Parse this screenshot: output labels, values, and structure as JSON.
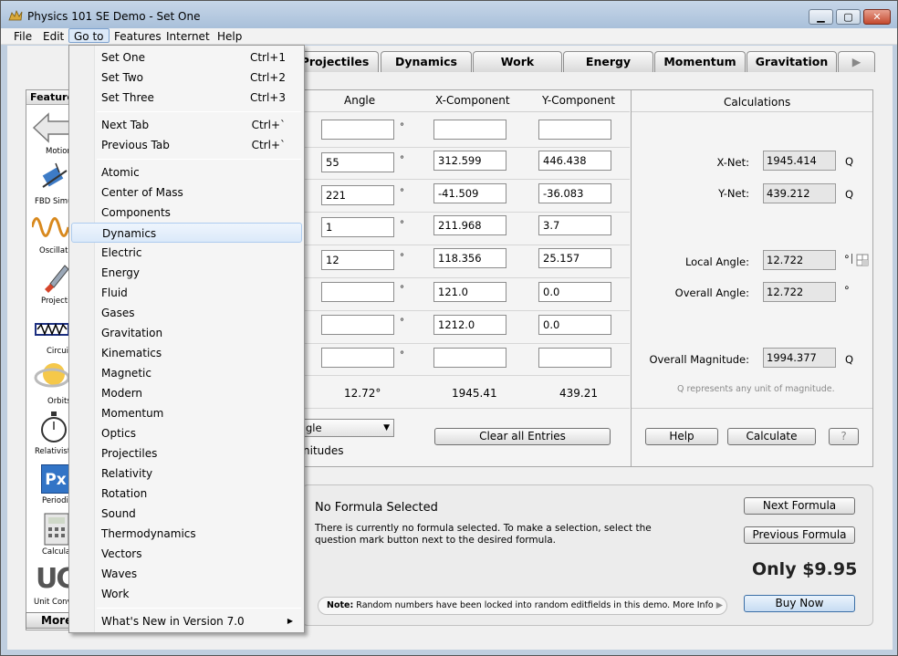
{
  "window": {
    "title": "Physics 101 SE Demo - Set One"
  },
  "menubar": {
    "items": [
      "File",
      "Edit",
      "Go to",
      "Features",
      "Internet",
      "Help"
    ]
  },
  "tabs": {
    "items": [
      "Projectiles",
      "Dynamics",
      "Work",
      "Energy",
      "Momentum",
      "Gravitation"
    ]
  },
  "sidebar": {
    "header": "Features",
    "items": [
      "Motion",
      "FBD Simu",
      "Oscillati",
      "Projectil",
      "Circuit",
      "Orbits",
      "Relativist",
      "Periodic",
      "Calculat",
      "Unit Conv"
    ],
    "more_label": "More",
    "periodic_glyph": "Px",
    "unit_glyph": "UC"
  },
  "table": {
    "headers": [
      "Angle",
      "X-Component",
      "Y-Component"
    ],
    "degree_symbol": "°",
    "rows": [
      {
        "angle": "",
        "x": "",
        "y": ""
      },
      {
        "angle": "55",
        "x": "312.599",
        "y": "446.438"
      },
      {
        "angle": "221",
        "x": "-41.509",
        "y": "-36.083"
      },
      {
        "angle": "1",
        "x": "211.968",
        "y": "3.7"
      },
      {
        "angle": "12",
        "x": "118.356",
        "y": "25.157"
      },
      {
        "angle": "",
        "x": "121.0",
        "y": "0.0"
      },
      {
        "angle": "",
        "x": "1212.0",
        "y": "0.0"
      },
      {
        "angle": "",
        "x": "",
        "y": ""
      }
    ],
    "totals": {
      "angle": "12.72°",
      "x": "1945.41",
      "y": "439.21"
    },
    "select_partial": "gle",
    "magnitudes_partial": "nitudes",
    "clear_button": "Clear all Entries"
  },
  "calculations": {
    "header": "Calculations",
    "xnet_label": "X-Net:",
    "xnet_value": "1945.414",
    "xnet_unit": "Q",
    "ynet_label": "Y-Net:",
    "ynet_value": "439.212",
    "ynet_unit": "Q",
    "local_angle_label": "Local Angle:",
    "local_angle_value": "12.722",
    "local_angle_unit": "°",
    "overall_angle_label": "Overall Angle:",
    "overall_angle_value": "12.722",
    "overall_angle_unit": "°",
    "overall_mag_label": "Overall Magnitude:",
    "overall_mag_value": "1994.377",
    "overall_mag_unit": "Q",
    "note": "Q represents any unit of magnitude.",
    "help_button": "Help",
    "calculate_button": "Calculate",
    "question_button": "?"
  },
  "formula": {
    "title": "No Formula Selected",
    "body_line1": "There is currently no formula selected. To make a selection, select the",
    "body_line2": "question mark button next to the desired formula.",
    "next_button": "Next Formula",
    "previous_button": "Previous Formula",
    "price": "Only $9.95",
    "buy_button": "Buy Now",
    "note_label": "Note:",
    "note_text": "Random numbers have been locked into random editfields in this demo.",
    "more_info": "More Info"
  },
  "goto_menu": {
    "items": [
      {
        "label": "Set One",
        "shortcut": "Ctrl+1"
      },
      {
        "label": "Set Two",
        "shortcut": "Ctrl+2"
      },
      {
        "label": "Set Three",
        "shortcut": "Ctrl+3"
      },
      {
        "label": "Next Tab",
        "shortcut": "Ctrl+`"
      },
      {
        "label": "Previous Tab",
        "shortcut": "Ctrl+`"
      },
      {
        "label": "Atomic"
      },
      {
        "label": "Center of Mass"
      },
      {
        "label": "Components"
      },
      {
        "label": "Dynamics"
      },
      {
        "label": "Electric"
      },
      {
        "label": "Energy"
      },
      {
        "label": "Fluid"
      },
      {
        "label": "Gases"
      },
      {
        "label": "Gravitation"
      },
      {
        "label": "Kinematics"
      },
      {
        "label": "Magnetic"
      },
      {
        "label": "Modern"
      },
      {
        "label": "Momentum"
      },
      {
        "label": "Optics"
      },
      {
        "label": "Projectiles"
      },
      {
        "label": "Relativity"
      },
      {
        "label": "Rotation"
      },
      {
        "label": "Sound"
      },
      {
        "label": "Thermodynamics"
      },
      {
        "label": "Vectors"
      },
      {
        "label": "Waves"
      },
      {
        "label": "Work"
      },
      {
        "label": "What's New in Version 7.0"
      }
    ],
    "highlighted": "Dynamics"
  },
  "colors": {
    "titlebar": "#b4c8df",
    "highlight": "#dbe9f9",
    "accent": "#3a6ea5"
  }
}
